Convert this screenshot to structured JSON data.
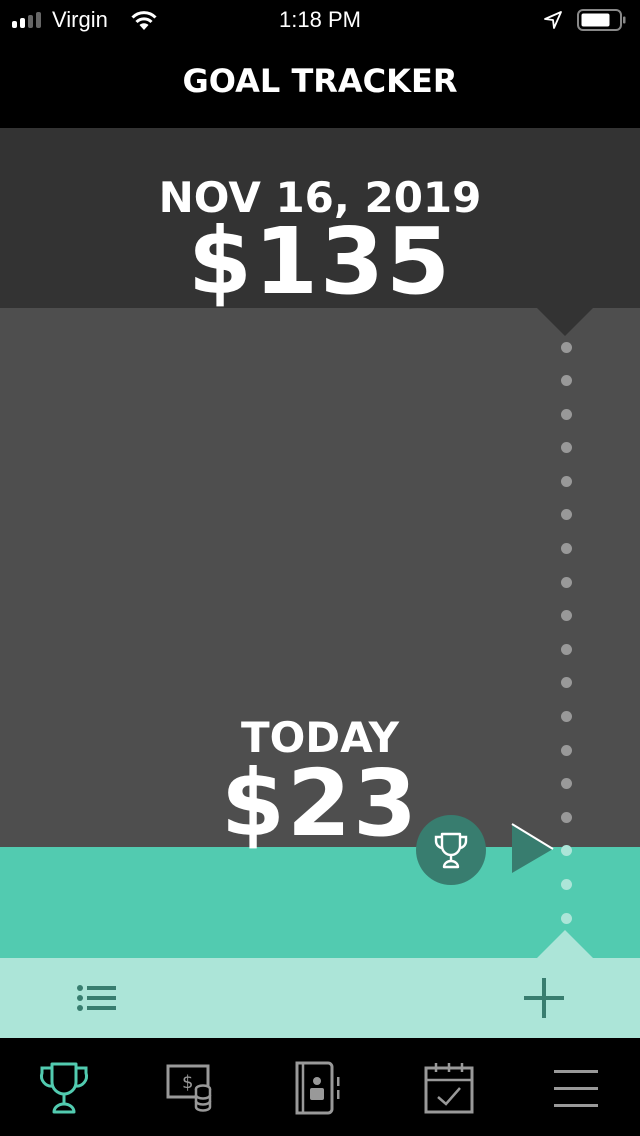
{
  "status_bar": {
    "carrier": "Virgin",
    "time": "1:18 PM",
    "signal_bars_active": 2,
    "signal_bars_total": 4,
    "icons": [
      "signal-icon",
      "wifi-icon",
      "location-arrow-icon",
      "battery-icon"
    ]
  },
  "nav": {
    "title": "GOAL TRACKER"
  },
  "goal": {
    "date": "NOV 16, 2019",
    "amount": "$135"
  },
  "today": {
    "label": "TODAY",
    "amount": "$23",
    "progress_fraction": 0.17
  },
  "progress_track": {
    "dot_count": 18,
    "filled_dot_count": 3
  },
  "actions": {
    "list_icon": "list-icon",
    "add_icon": "plus-icon"
  },
  "tabs": [
    {
      "id": "goals",
      "icon": "trophy-icon",
      "active": true
    },
    {
      "id": "money",
      "icon": "money-coins-icon",
      "active": false
    },
    {
      "id": "contacts",
      "icon": "address-book-icon",
      "active": false
    },
    {
      "id": "calendar",
      "icon": "calendar-check-icon",
      "active": false
    },
    {
      "id": "menu",
      "icon": "hamburger-menu-icon",
      "active": false
    }
  ],
  "colors": {
    "header_dark": "#333333",
    "track_gray": "#4e4e4e",
    "fill_teal": "#52cbb0",
    "action_bar_mint": "#ace5d8",
    "accent_dark_teal": "#387d6f",
    "tab_active": "#52cbb0",
    "tab_inactive": "#999999",
    "dot_gray": "#999999",
    "dot_light": "#ace5d8"
  }
}
